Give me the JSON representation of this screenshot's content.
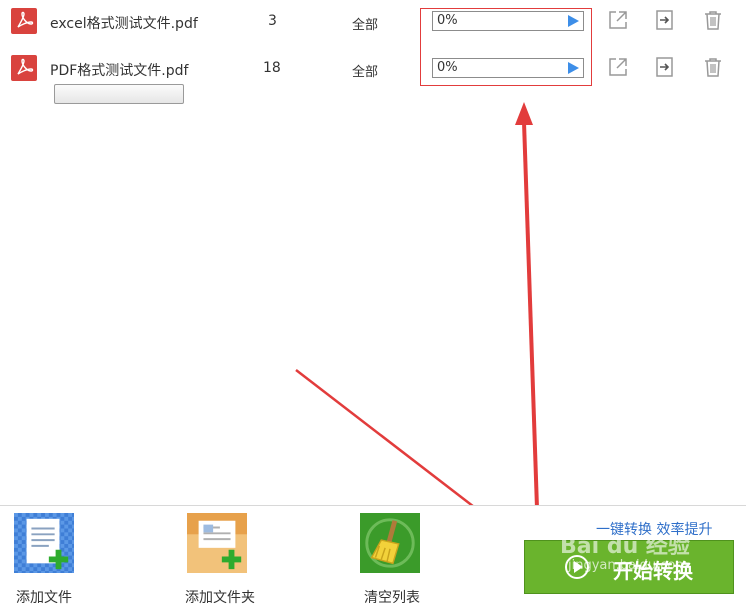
{
  "files": [
    {
      "name": "excel格式测试文件.pdf",
      "pages": "3",
      "range": "全部",
      "progress": "0%",
      "progress_fraction": 0
    },
    {
      "name": "PDF格式测试文件.pdf",
      "pages": "18",
      "range": "全部",
      "progress": "0%",
      "progress_fraction": 0
    }
  ],
  "toolbar": {
    "add_file": "添加文件",
    "add_folder": "添加文件夹",
    "clear_list": "清空列表"
  },
  "slogan": "一键转换 效率提升",
  "start_button": "开始转换",
  "watermark": {
    "logo": "Bai du 经验",
    "url": "jingyan.baidu.com"
  },
  "colors": {
    "accent_green": "#6ab42d",
    "pdf_red": "#d9433e",
    "annotation_red": "#e23c3c",
    "link_blue": "#2f6fc9",
    "progress_play": "#3d8ee8"
  }
}
